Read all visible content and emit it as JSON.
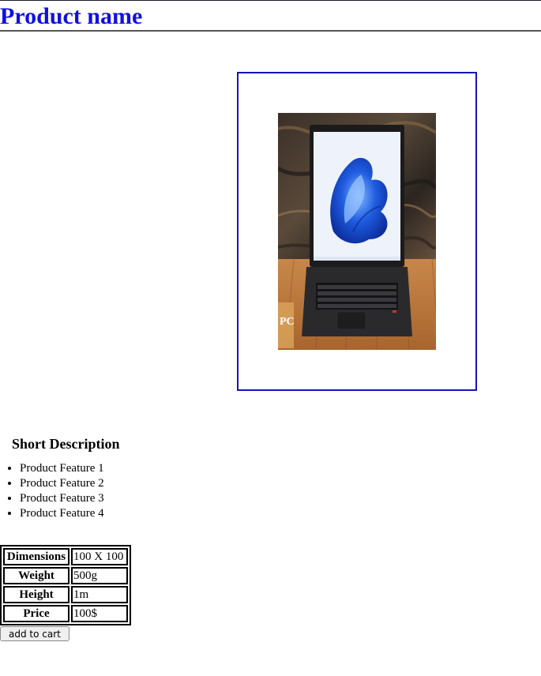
{
  "header": {
    "title": "Product name"
  },
  "product_image": {
    "alt": "Laptop product photo"
  },
  "description": {
    "title": "Short Description",
    "features": [
      "Product Feature 1",
      "Product Feature 2",
      "Product Feature 3",
      "Product Feature 4"
    ]
  },
  "specs": [
    {
      "label": "Dimensions",
      "value": "100 X 100"
    },
    {
      "label": "Weight",
      "value": "500g"
    },
    {
      "label": "Height",
      "value": "1m"
    },
    {
      "label": "Price",
      "value": "100$"
    }
  ],
  "cart": {
    "button_label": "add to cart"
  },
  "colors": {
    "title": "#1010e0",
    "frame_border": "#1414b8"
  }
}
